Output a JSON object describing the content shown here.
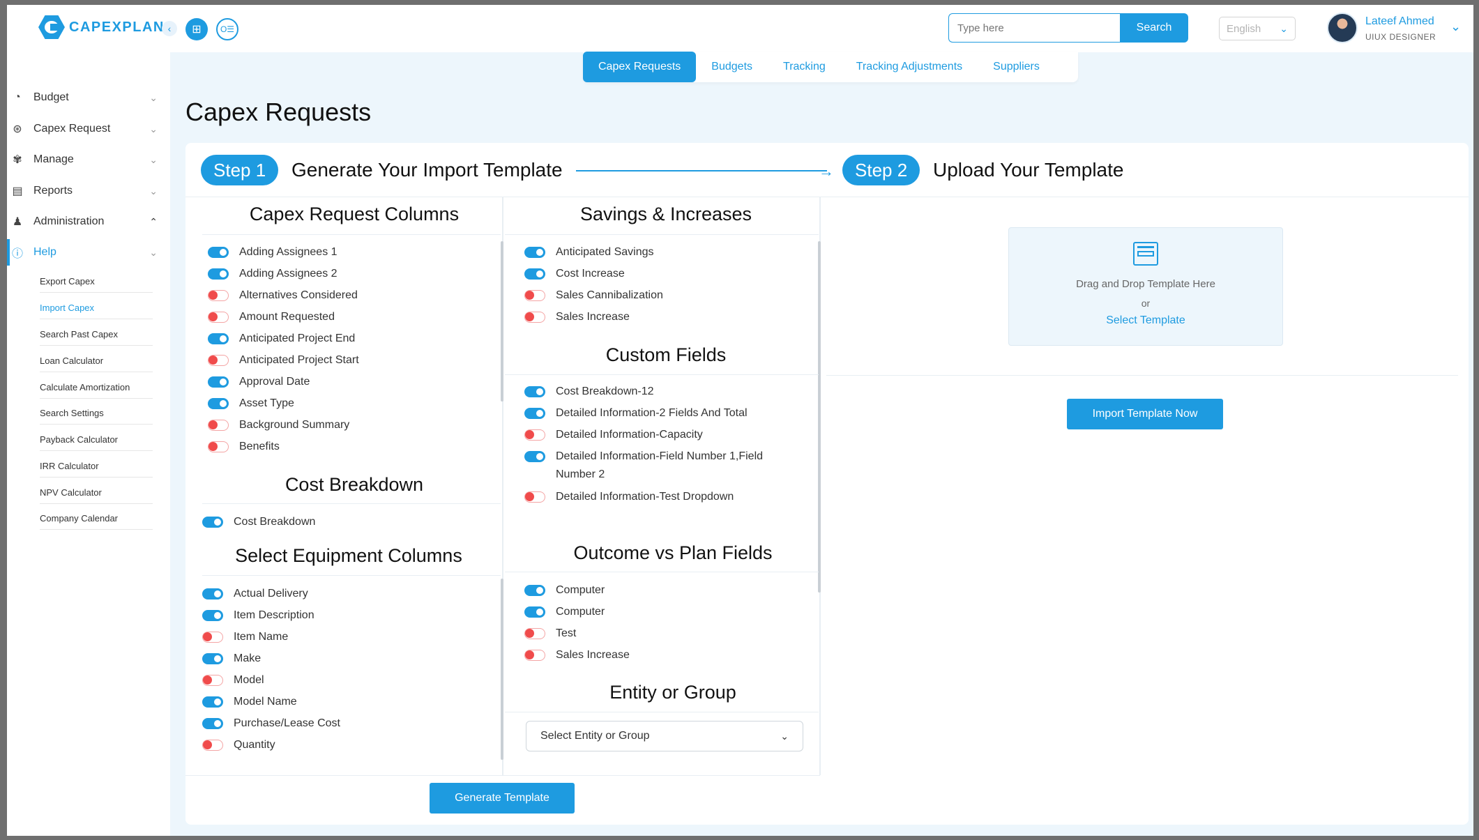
{
  "app": {
    "logo_text": "CAPEXPLAN"
  },
  "header": {
    "search_placeholder": "Type here",
    "search_label": "Search",
    "language": "English",
    "user_name": "Lateef Ahmed",
    "user_role": "UIUX DESIGNER"
  },
  "sidebar": {
    "items": [
      {
        "label": "Budget",
        "icon": "budget-icon"
      },
      {
        "label": "Capex Request",
        "icon": "capex-icon"
      },
      {
        "label": "Manage",
        "icon": "manage-icon"
      },
      {
        "label": "Reports",
        "icon": "reports-icon"
      },
      {
        "label": "Administration",
        "icon": "admin-icon"
      },
      {
        "label": "Help",
        "icon": "help-icon"
      }
    ],
    "sub_items": [
      "Export Capex",
      "Import Capex",
      "Search Past Capex",
      "Loan Calculator",
      "Calculate Amortization",
      "Search Settings",
      "Payback Calculator",
      "IRR Calculator",
      "NPV Calculator",
      "Company Calendar"
    ]
  },
  "tabs": [
    "Capex Requests",
    "Budgets",
    "Tracking",
    "Tracking Adjustments",
    "Suppliers"
  ],
  "page_title": "Capex Requests",
  "steps": {
    "step1_label": "Step 1",
    "step1_title": "Generate Your Import Template",
    "step2_label": "Step 2",
    "step2_title": "Upload Your Template"
  },
  "sections": {
    "capex_columns": {
      "title": "Capex Request Columns",
      "items": [
        {
          "label": "Adding Assignees 1",
          "on": true
        },
        {
          "label": "Adding Assignees 2",
          "on": true
        },
        {
          "label": "Alternatives Considered",
          "on": false
        },
        {
          "label": "Amount Requested",
          "on": false
        },
        {
          "label": "Anticipated Project End",
          "on": true
        },
        {
          "label": "Anticipated Project Start",
          "on": false
        },
        {
          "label": "Approval Date",
          "on": true
        },
        {
          "label": "Asset Type",
          "on": true
        },
        {
          "label": "Background Summary",
          "on": false
        },
        {
          "label": "Benefits",
          "on": false
        }
      ]
    },
    "cost_breakdown": {
      "title": "Cost Breakdown",
      "items": [
        {
          "label": "Cost Breakdown",
          "on": true
        }
      ]
    },
    "equipment_columns": {
      "title": "Select Equipment Columns",
      "items": [
        {
          "label": "Actual Delivery",
          "on": true
        },
        {
          "label": "Item Description",
          "on": true
        },
        {
          "label": "Item Name",
          "on": false
        },
        {
          "label": "Make",
          "on": true
        },
        {
          "label": "Model",
          "on": false
        },
        {
          "label": "Model Name",
          "on": true
        },
        {
          "label": "Purchase/Lease Cost",
          "on": true
        },
        {
          "label": "Quantity",
          "on": false
        }
      ]
    },
    "savings": {
      "title": "Savings & Increases",
      "items": [
        {
          "label": "Anticipated Savings",
          "on": true
        },
        {
          "label": "Cost Increase",
          "on": true
        },
        {
          "label": "Sales Cannibalization",
          "on": false
        },
        {
          "label": "Sales Increase",
          "on": false
        }
      ]
    },
    "custom_fields": {
      "title": "Custom Fields",
      "items": [
        {
          "label": "Cost Breakdown-12",
          "on": true
        },
        {
          "label": "Detailed Information-2 Fields And Total",
          "on": true
        },
        {
          "label": "Detailed Information-Capacity",
          "on": false
        },
        {
          "label": "Detailed Information-Field Number 1,Field Number 2",
          "on": true
        },
        {
          "label": "Detailed Information-Test Dropdown",
          "on": false
        }
      ]
    },
    "outcome": {
      "title": "Outcome vs Plan Fields",
      "items": [
        {
          "label": "Computer",
          "on": true
        },
        {
          "label": "Computer",
          "on": true
        },
        {
          "label": "Test",
          "on": false
        },
        {
          "label": "Sales Increase",
          "on": false
        }
      ]
    },
    "entity": {
      "title": "Entity or Group",
      "select_placeholder": "Select Entity or Group"
    }
  },
  "buttons": {
    "generate": "Generate Template",
    "import": "Import Template Now"
  },
  "upload": {
    "drag_text": "Drag and Drop Template Here",
    "or_text": "or",
    "select_link": "Select Template"
  },
  "colors": {
    "accent": "#1e9be0",
    "off_toggle": "#f04b4b",
    "main_bg": "#edf6fc"
  }
}
